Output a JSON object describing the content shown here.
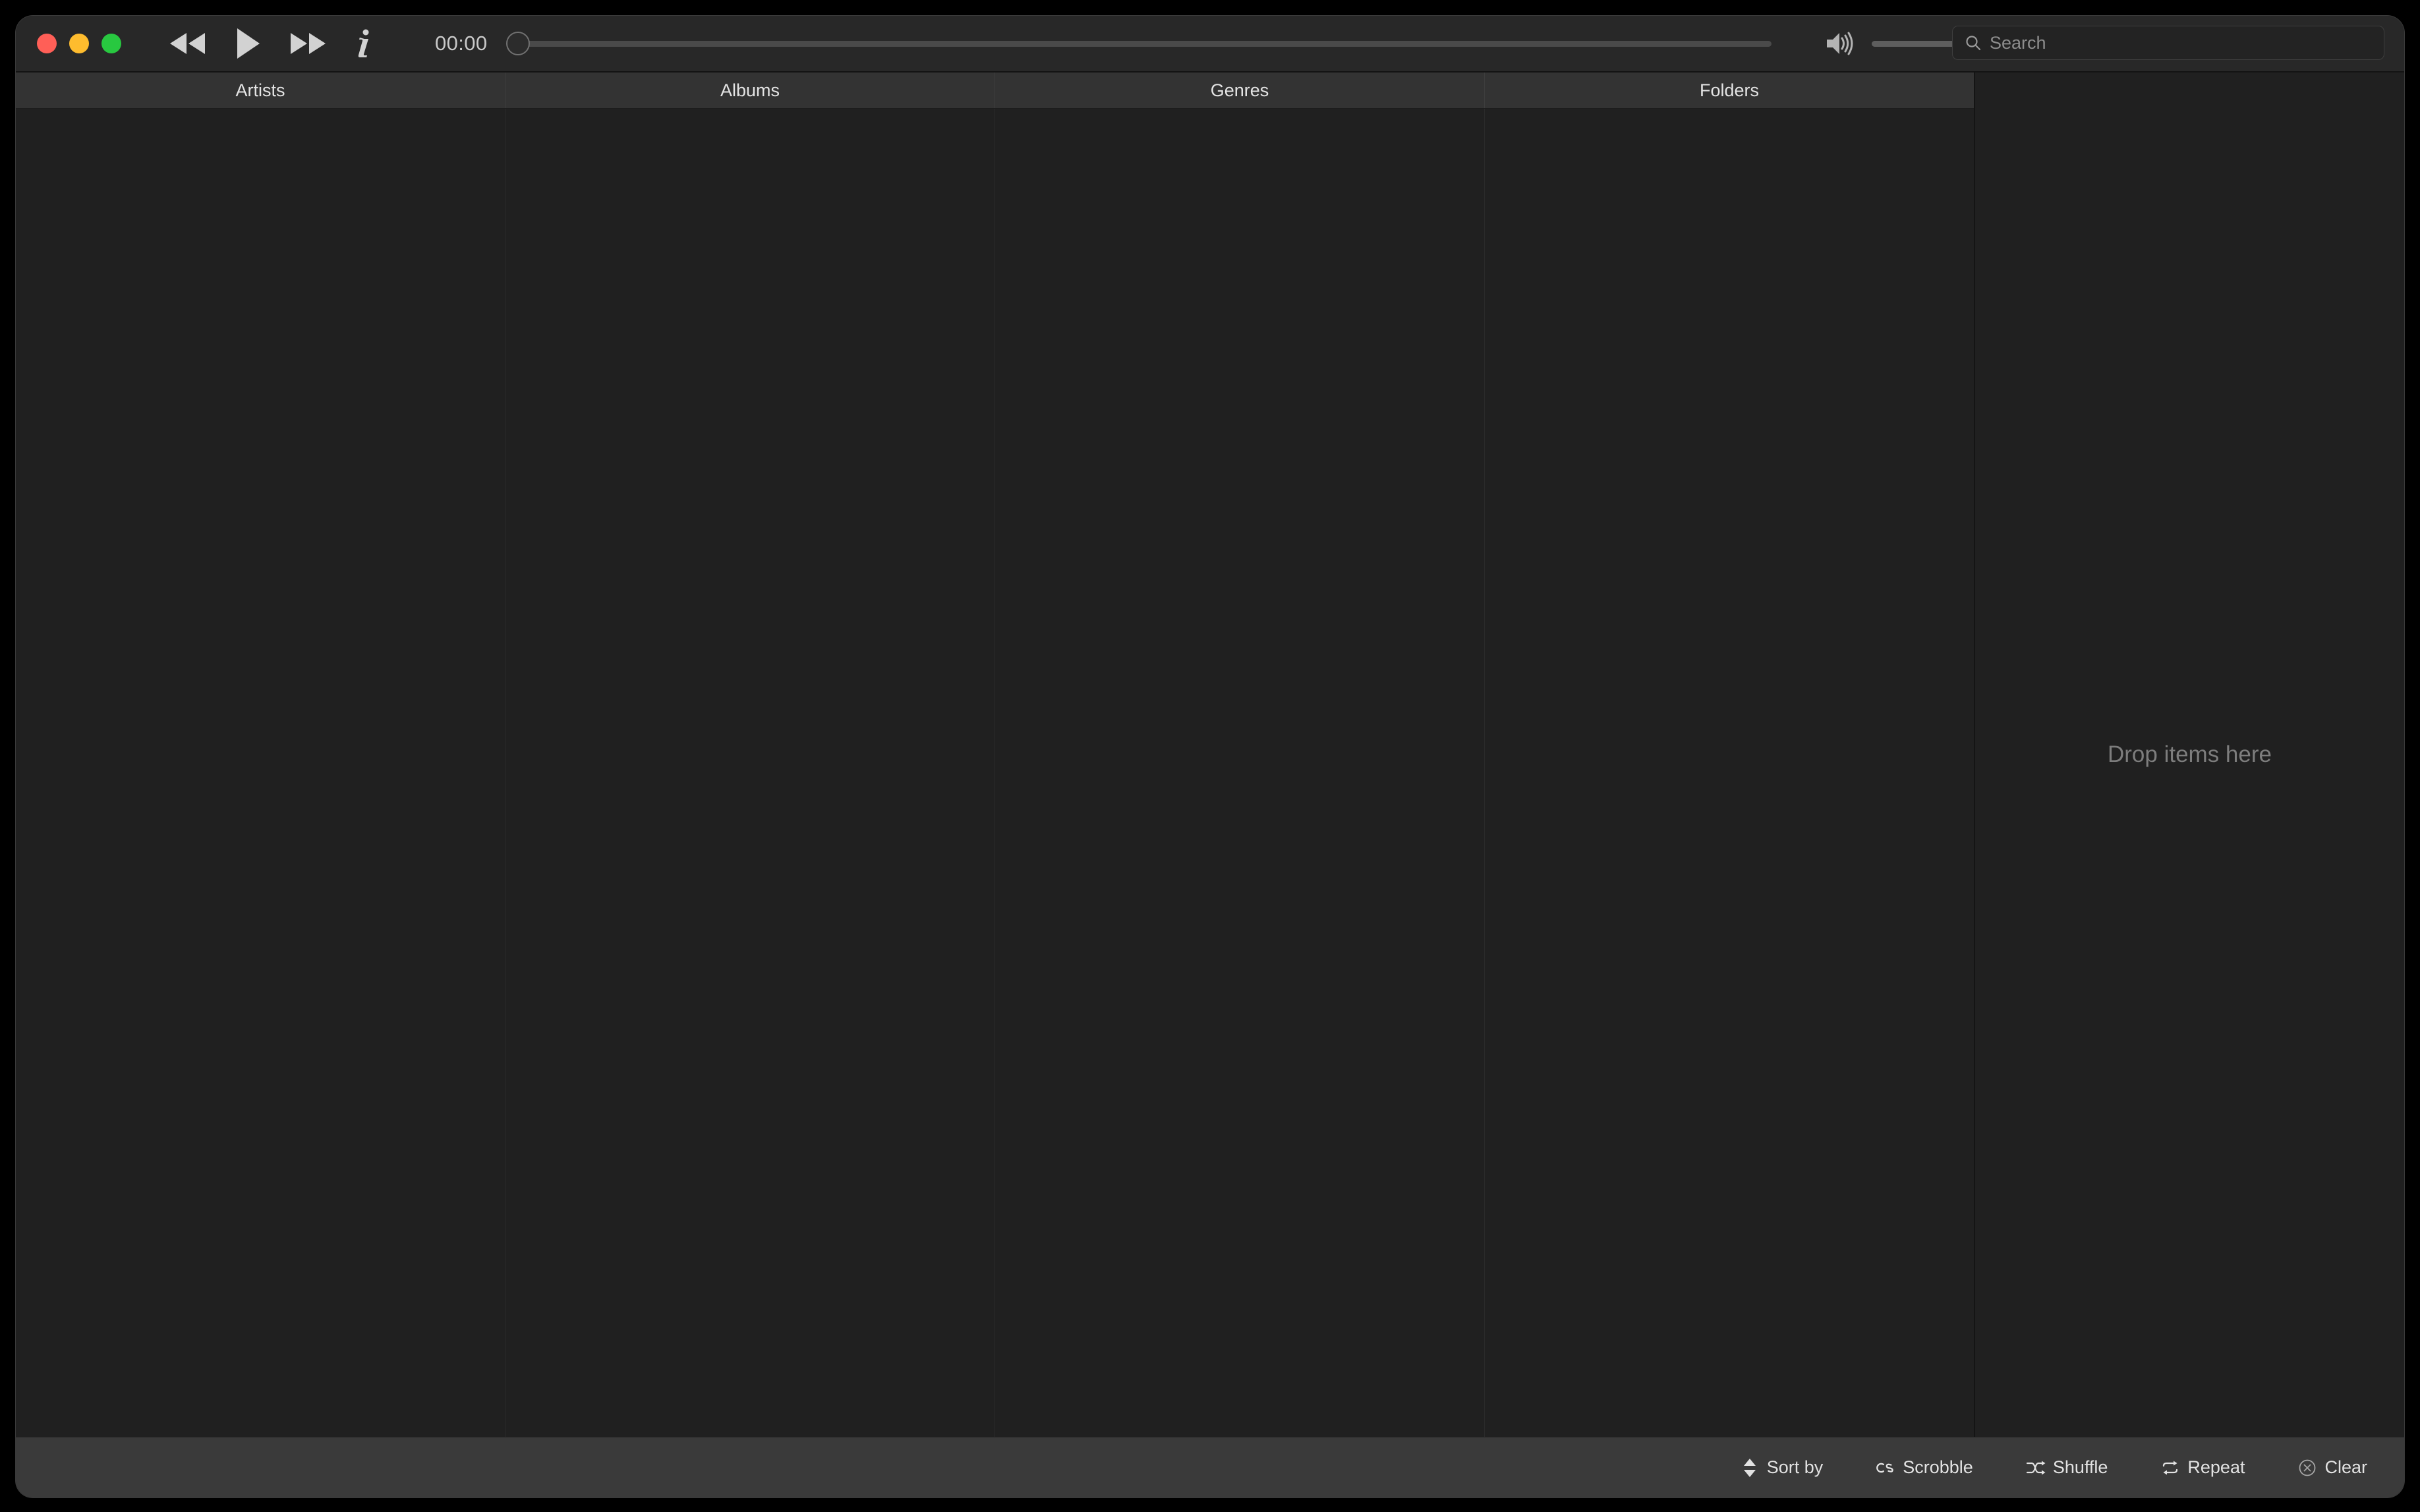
{
  "window": {
    "traffic_lights": [
      {
        "name": "close",
        "color": "#FF5F57"
      },
      {
        "name": "minimize",
        "color": "#FEBC2E"
      },
      {
        "name": "maximize",
        "color": "#28C840"
      }
    ]
  },
  "toolbar": {
    "previous_label": "Previous",
    "play_label": "Play",
    "next_label": "Next",
    "info_label": "Info",
    "elapsed_time": "00:00",
    "seek_percent": 0,
    "volume_percent": 100,
    "volume_icon": "speaker-wave-icon"
  },
  "search": {
    "placeholder": "Search",
    "value": "",
    "icon": "search-icon"
  },
  "browser": {
    "columns": [
      {
        "label": "Artists",
        "items": []
      },
      {
        "label": "Albums",
        "items": []
      },
      {
        "label": "Genres",
        "items": []
      },
      {
        "label": "Folders",
        "items": []
      }
    ]
  },
  "playlist": {
    "empty_message": "Drop items here",
    "items": []
  },
  "status_bar": {
    "buttons": [
      {
        "label": "Sort by",
        "icon": "sort-updown-icon"
      },
      {
        "label": "Scrobble",
        "icon": "lastfm-scrobble-icon"
      },
      {
        "label": "Shuffle",
        "icon": "shuffle-icon"
      },
      {
        "label": "Repeat",
        "icon": "repeat-icon"
      },
      {
        "label": "Clear",
        "icon": "clear-circle-x-icon"
      }
    ]
  },
  "colors": {
    "window_background": "#202020",
    "toolbar_background": "#282828",
    "header_background": "#333333",
    "status_bar_background": "#3a3a3a",
    "text_primary": "#e4e4e4",
    "text_muted": "#7d7d7d"
  }
}
